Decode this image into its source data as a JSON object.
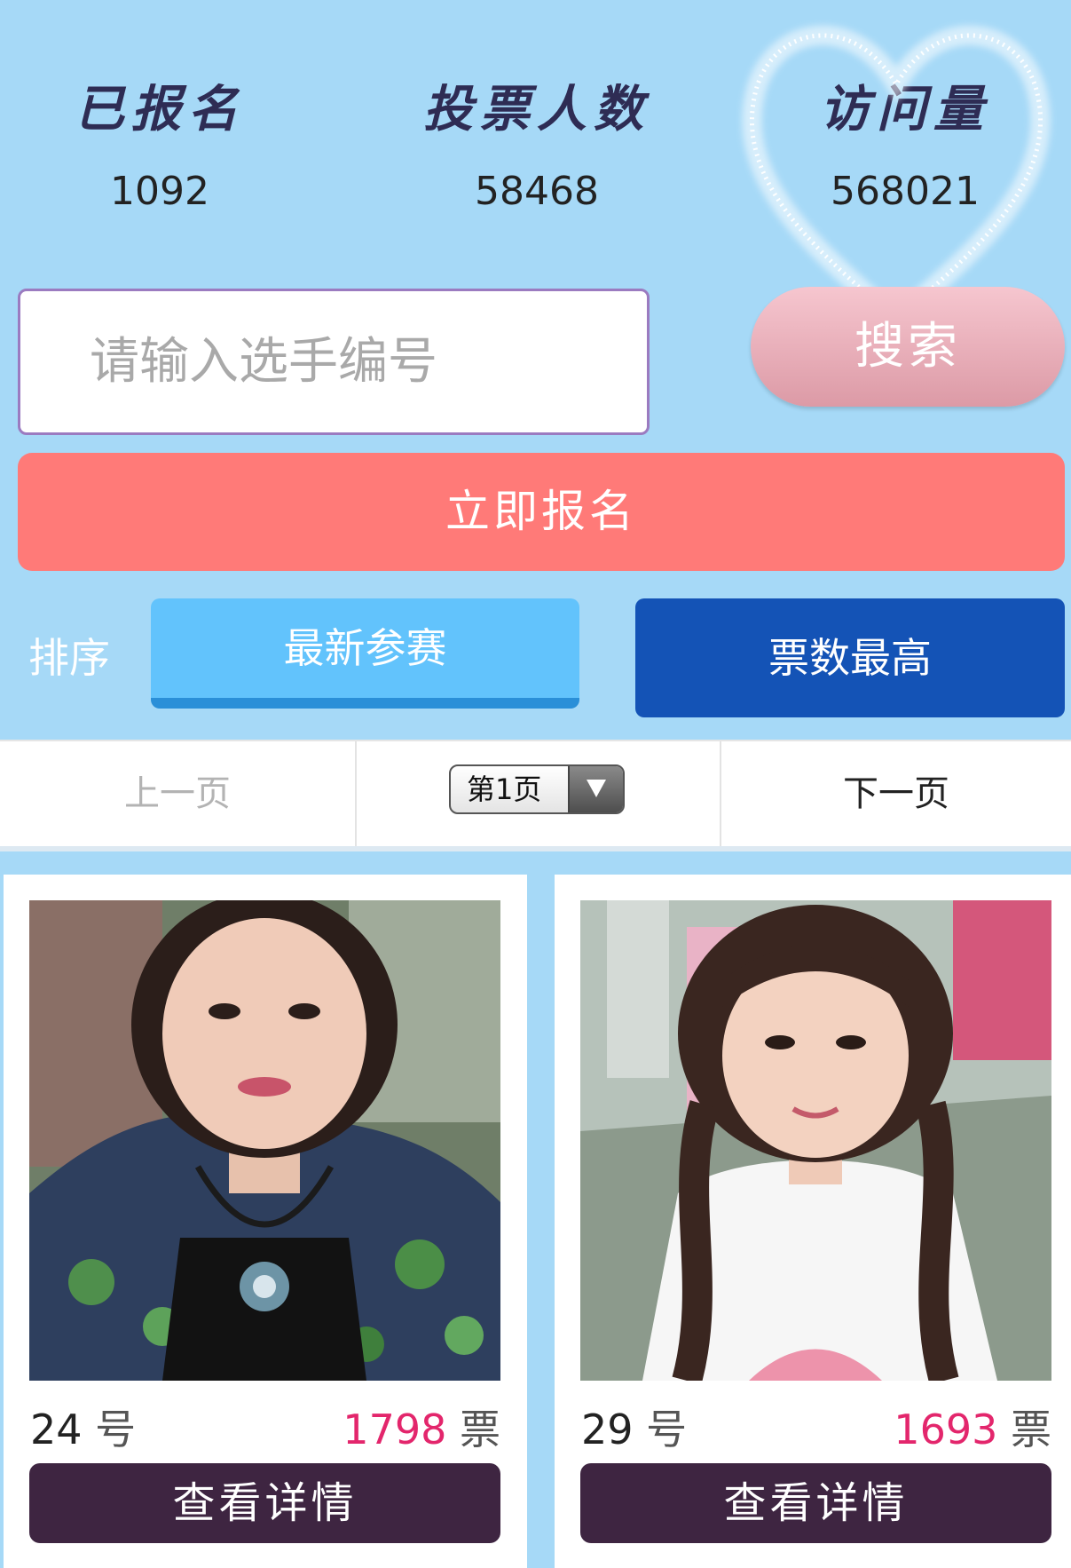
{
  "stats": [
    {
      "label": "已报名",
      "value": "1092"
    },
    {
      "label": "投票人数",
      "value": "58468"
    },
    {
      "label": "访问量",
      "value": "568021"
    }
  ],
  "search": {
    "placeholder": "请输入选手编号",
    "button_label": "搜索"
  },
  "signup_label": "立即报名",
  "sort": {
    "label": "排序",
    "newest": "最新参赛",
    "most_votes": "票数最高"
  },
  "pager": {
    "prev": "上一页",
    "current": "第1页",
    "next": "下一页"
  },
  "contestants": [
    {
      "number": "24",
      "number_suffix": "号",
      "votes": "1798",
      "votes_suffix": "票",
      "detail_label": "查看详情"
    },
    {
      "number": "29",
      "number_suffix": "号",
      "votes": "1693",
      "votes_suffix": "票",
      "detail_label": "查看详情"
    }
  ],
  "colors": {
    "background": "#a6d9f7",
    "signup": "#ff7a78",
    "sort_new": "#62c3fc",
    "sort_votes": "#1453b6",
    "detail_button": "#3e2541",
    "vote_count": "#e3266c"
  },
  "icons": {
    "heart_decoration": "sparkler-heart-icon",
    "dropdown": "triangle-down-icon"
  }
}
